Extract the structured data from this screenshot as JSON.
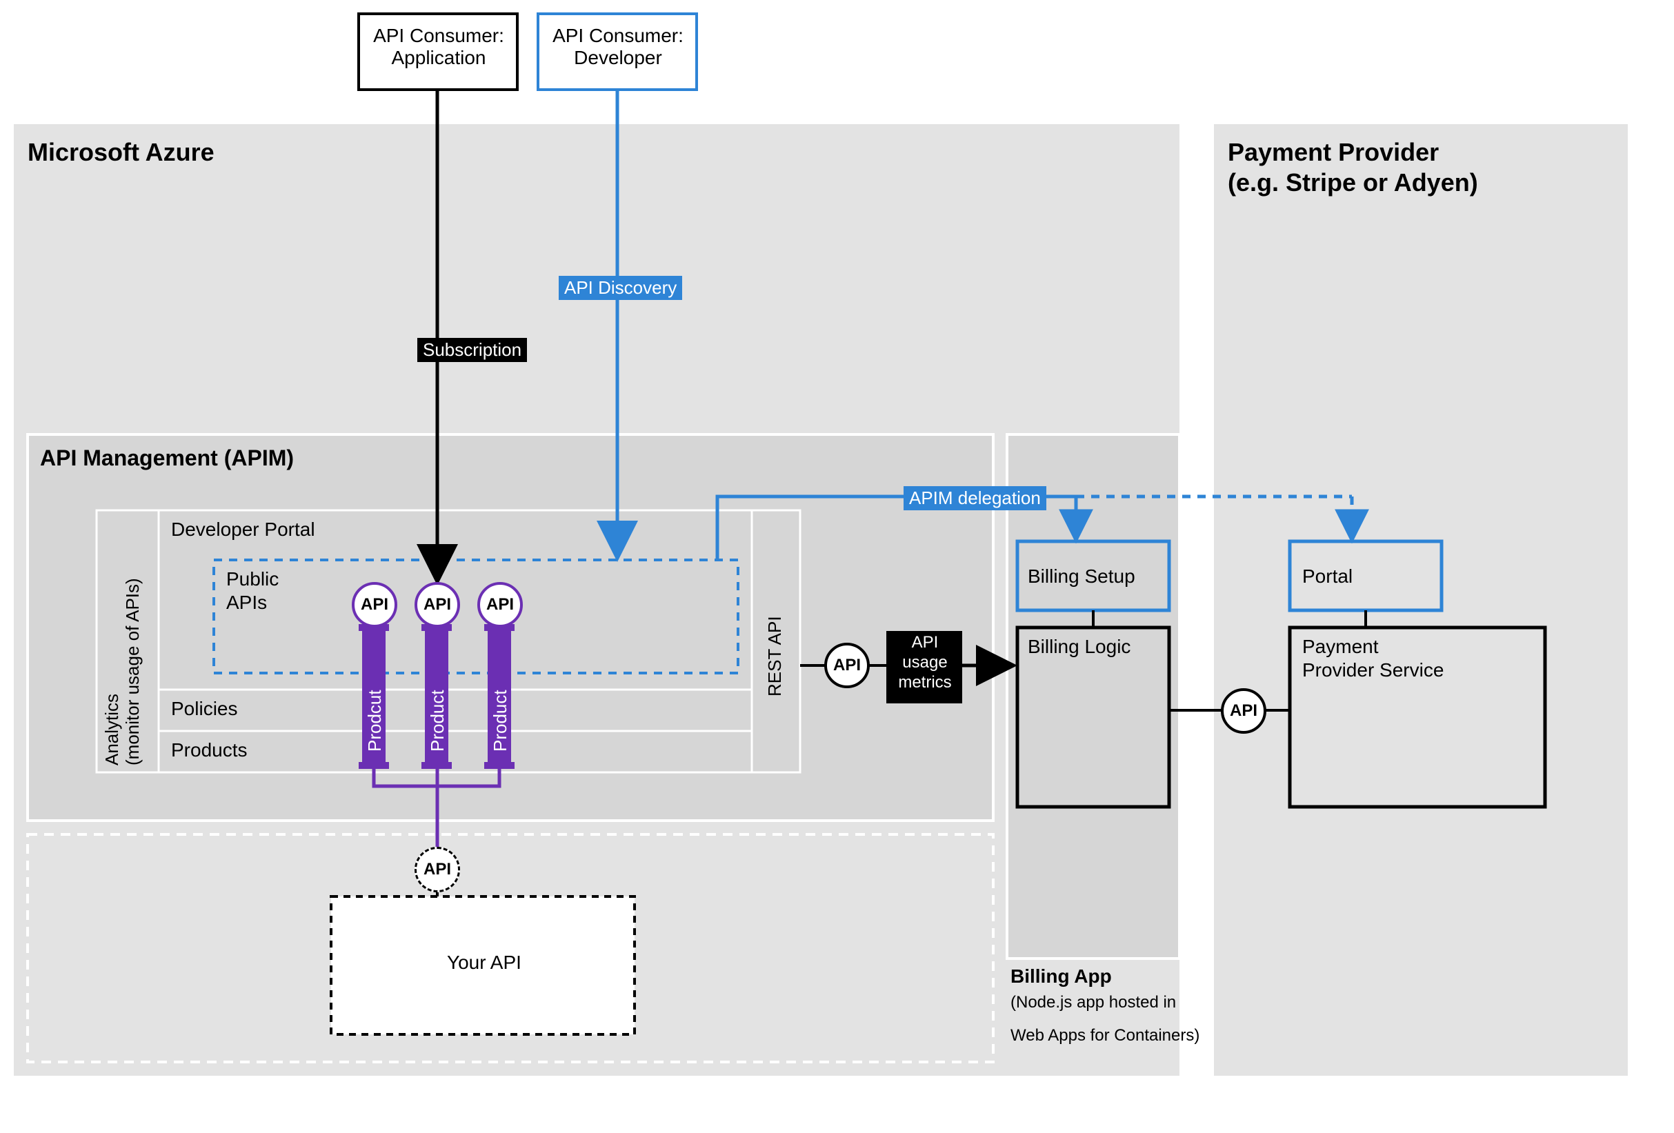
{
  "consumers": {
    "app": {
      "line1": "API Consumer:",
      "line2": "Application"
    },
    "dev": {
      "line1": "API Consumer:",
      "line2": "Developer"
    }
  },
  "azure": {
    "title": "Microsoft Azure"
  },
  "payment": {
    "title1": "Payment Provider",
    "title2": "(e.g. Stripe or Adyen)"
  },
  "apim": {
    "title": "API Management (APIM)",
    "analytics": {
      "line1": "Analytics",
      "line2": "(monitor usage of APIs)"
    },
    "devportal": "Developer Portal",
    "public_apis": {
      "line1": "Public",
      "line2": "APIs"
    },
    "policies": "Policies",
    "products": "Products",
    "rest_api": "REST API",
    "product_pill": "Product",
    "product_pill_typo": "Prodcut"
  },
  "flows": {
    "subscription": "Subscription",
    "api_discovery": "API Discovery",
    "apim_delegation": "APIM delegation",
    "api_usage_metrics": {
      "line1": "API",
      "line2": "usage",
      "line3": "metrics"
    }
  },
  "your_api": {
    "label": "Your API"
  },
  "billing": {
    "setup": "Billing Setup",
    "logic": "Billing Logic",
    "app_title": "Billing App",
    "app_sub1": "(Node.js app hosted in",
    "app_sub2": "Web Apps for Containers)"
  },
  "provider": {
    "portal": "Portal",
    "service": {
      "line1": "Payment",
      "line2": "Provider Service"
    }
  },
  "api_badge": "API"
}
